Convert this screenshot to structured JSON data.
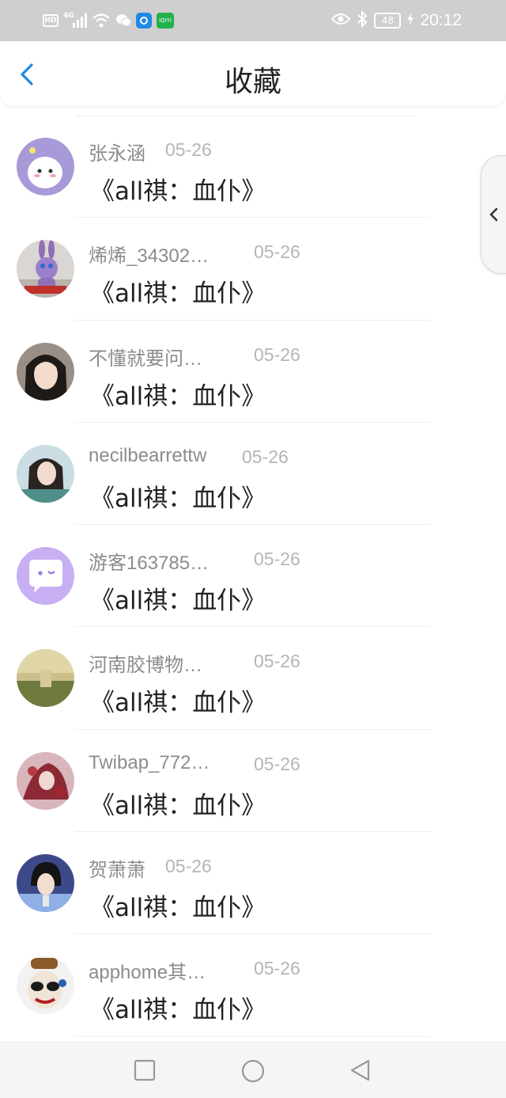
{
  "status_bar": {
    "left_icons": [
      "hd-icon",
      "signal-icon",
      "wifi-icon",
      "wechat-icon",
      "app-icon",
      "iqiyi-icon"
    ],
    "hd": "HD",
    "signal": "4G",
    "iqiyi": "iQIYI",
    "battery": "48",
    "time": "20:12"
  },
  "header": {
    "title": "收藏"
  },
  "items": [
    {
      "name": "张永涵",
      "date": "05-26",
      "content": "《all祺：血仆》"
    },
    {
      "name": "烯烯_34302…",
      "date": "05-26",
      "content": "《all祺：血仆》"
    },
    {
      "name": "不懂就要问…",
      "date": "05-26",
      "content": "《all祺：血仆》"
    },
    {
      "name": "necilbearrettw",
      "date": "05-26",
      "content": "《all祺：血仆》"
    },
    {
      "name": "游客163785…",
      "date": "05-26",
      "content": "《all祺：血仆》"
    },
    {
      "name": "河南胶博物…",
      "date": "05-26",
      "content": "《all祺：血仆》"
    },
    {
      "name": "Twibap_772…",
      "date": "05-26",
      "content": "《all祺：血仆》"
    },
    {
      "name": "贺萧萧",
      "date": "05-26",
      "content": "《all祺：血仆》"
    },
    {
      "name": "apphome其…",
      "date": "05-26",
      "content": "《all祺：血仆》"
    }
  ],
  "colors": {
    "accent": "#1e88e5",
    "name_text": "#8c8c8c",
    "date_text": "#b5b5b5",
    "status_bar_bg": "#cfcfcf"
  }
}
